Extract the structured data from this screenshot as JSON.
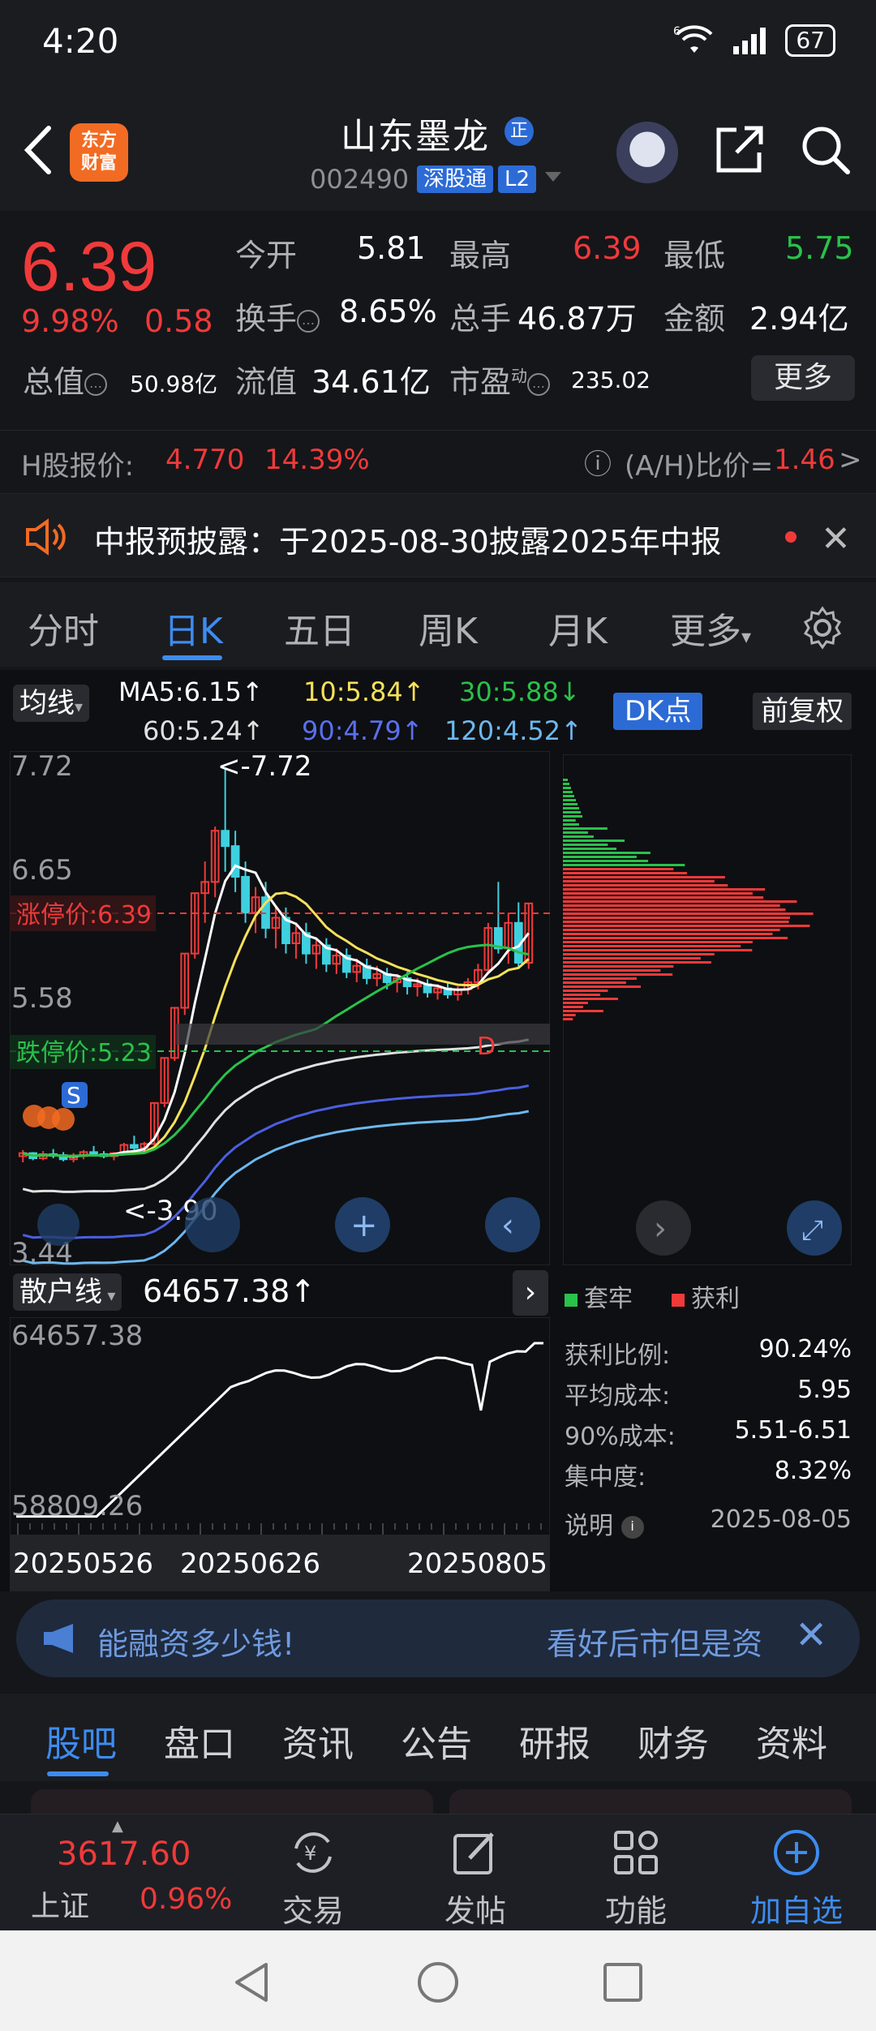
{
  "status": {
    "time": "4:20",
    "battery": "67",
    "wifi_label": "6"
  },
  "header": {
    "app_logo": "东方\n财富",
    "stock_name": "山东墨龙",
    "zheng_badge": "正",
    "stock_code": "002490",
    "sgt_badge": "深股通",
    "l2_badge": "L2"
  },
  "quote": {
    "price": "6.39",
    "pct": "9.98%",
    "chg": "0.58",
    "open_label": "今开",
    "open": "5.81",
    "high_label": "最高",
    "high": "6.39",
    "low_label": "最低",
    "low": "5.75",
    "turnover_label": "换手",
    "turnover": "8.65%",
    "volume_label": "总手",
    "volume": "46.87万",
    "amount_label": "金额",
    "amount": "2.94亿",
    "total_mv_label": "总值",
    "total_mv": "50.98亿",
    "float_mv_label": "流值",
    "float_mv": "34.61亿",
    "pe_label": "市盈",
    "pe_sup": "动",
    "pe": "235.02",
    "more_label": "更多",
    "h_label": "H股报价:",
    "h_price": "4.770",
    "h_premium": "14.39%",
    "ah_label": "(A/H)比价=",
    "ah_value": "1.46",
    "ah_arrow": ">"
  },
  "notice": {
    "text": "中报预披露：于2025-08-30披露2025年中报"
  },
  "ktabs": [
    "分时",
    "日K",
    "五日",
    "周K",
    "月K",
    "更多"
  ],
  "ktab_active": 1,
  "ma_row": {
    "selector": "均线",
    "ma5": "MA5:6.15↑",
    "ma10": "10:5.84↑",
    "ma30": "30:5.88↓",
    "ma60": "60:5.24↑",
    "ma90": "90:4.79↑",
    "ma120": "120:4.52↑",
    "dk": "DK点",
    "fuquan": "前复权"
  },
  "colors": {
    "ma5": "#ffffff",
    "ma10": "#f5e15a",
    "ma30": "#29c24a",
    "ma60": "#e0e0e0",
    "ma90": "#4a5fe0",
    "ma120": "#6cb8f0",
    "up": "#f03a3a",
    "down": "#3fd0e0"
  },
  "kline": {
    "y_labels": [
      "7.72",
      "6.65",
      "5.58",
      "3.44"
    ],
    "limit_up": "涨停价:6.39",
    "limit_down": "跌停价:5.23",
    "high_mark": "<-7.72",
    "low_mark": "<-3.90",
    "marker_d": "D",
    "marker_s": "S"
  },
  "chart_data": {
    "type": "candlestick",
    "title": "",
    "ylim": [
      3.44,
      7.72
    ],
    "x": [
      "20250526",
      "20250626",
      "20250805"
    ],
    "candles": [
      [
        3.92,
        3.98,
        3.86,
        3.95
      ],
      [
        3.95,
        3.96,
        3.88,
        3.9
      ],
      [
        3.9,
        3.97,
        3.88,
        3.94
      ],
      [
        3.94,
        3.99,
        3.9,
        3.93
      ],
      [
        3.93,
        3.96,
        3.87,
        3.89
      ],
      [
        3.89,
        3.95,
        3.86,
        3.92
      ],
      [
        3.92,
        3.98,
        3.89,
        3.96
      ],
      [
        3.96,
        4.02,
        3.92,
        3.94
      ],
      [
        3.94,
        3.97,
        3.9,
        3.92
      ],
      [
        3.92,
        3.96,
        3.88,
        3.95
      ],
      [
        3.95,
        4.05,
        3.93,
        4.03
      ],
      [
        4.03,
        4.12,
        3.98,
        4.0
      ],
      [
        4.0,
        4.06,
        3.95,
        4.04
      ],
      [
        4.04,
        4.44,
        4.02,
        4.44
      ],
      [
        4.44,
        4.88,
        4.4,
        4.88
      ],
      [
        4.88,
        5.37,
        4.85,
        5.37
      ],
      [
        5.37,
        5.9,
        5.3,
        5.9
      ],
      [
        5.9,
        6.49,
        5.85,
        6.49
      ],
      [
        6.49,
        6.8,
        6.2,
        6.6
      ],
      [
        6.6,
        7.14,
        6.45,
        7.1
      ],
      [
        7.1,
        7.72,
        6.7,
        6.95
      ],
      [
        6.95,
        7.1,
        6.5,
        6.65
      ],
      [
        6.65,
        6.8,
        6.2,
        6.3
      ],
      [
        6.3,
        6.55,
        6.1,
        6.45
      ],
      [
        6.45,
        6.6,
        6.05,
        6.15
      ],
      [
        6.15,
        6.35,
        5.95,
        6.25
      ],
      [
        6.25,
        6.35,
        5.9,
        6.0
      ],
      [
        6.0,
        6.2,
        5.85,
        6.1
      ],
      [
        6.1,
        6.2,
        5.8,
        5.9
      ],
      [
        5.9,
        6.05,
        5.75,
        5.98
      ],
      [
        5.98,
        6.05,
        5.72,
        5.8
      ],
      [
        5.8,
        5.95,
        5.7,
        5.88
      ],
      [
        5.88,
        5.95,
        5.66,
        5.72
      ],
      [
        5.72,
        5.85,
        5.62,
        5.78
      ],
      [
        5.78,
        5.85,
        5.6,
        5.66
      ],
      [
        5.66,
        5.78,
        5.58,
        5.7
      ],
      [
        5.7,
        5.76,
        5.55,
        5.62
      ],
      [
        5.62,
        5.7,
        5.52,
        5.66
      ],
      [
        5.66,
        5.72,
        5.5,
        5.58
      ],
      [
        5.58,
        5.66,
        5.48,
        5.6
      ],
      [
        5.6,
        5.65,
        5.47,
        5.52
      ],
      [
        5.52,
        5.6,
        5.45,
        5.56
      ],
      [
        5.56,
        5.62,
        5.46,
        5.5
      ],
      [
        5.5,
        5.58,
        5.44,
        5.55
      ],
      [
        5.55,
        5.66,
        5.5,
        5.62
      ],
      [
        5.62,
        5.8,
        5.55,
        5.74
      ],
      [
        5.74,
        6.2,
        5.7,
        6.15
      ],
      [
        6.15,
        6.6,
        5.9,
        5.95
      ],
      [
        5.95,
        6.3,
        5.8,
        6.2
      ],
      [
        6.2,
        6.4,
        5.75,
        5.81
      ],
      [
        5.81,
        6.39,
        5.75,
        6.39
      ]
    ]
  },
  "scatter": {
    "selector": "散户线",
    "value": "64657.38↑",
    "y_top": "64657.38",
    "y_bottom": "58809.26"
  },
  "dates": [
    "20250526",
    "20250626",
    "20250805"
  ],
  "distribution": {
    "legend_trap": "套牢",
    "legend_profit": "获利",
    "profit_ratio_label": "获利比例:",
    "profit_ratio": "90.24%",
    "avg_cost_label": "平均成本:",
    "avg_cost": "5.95",
    "cost90_label": "90%成本:",
    "cost90": "5.51-6.51",
    "concentration_label": "集中度:",
    "concentration": "8.32%",
    "explain_label": "说明",
    "date": "2025-08-05"
  },
  "promo": {
    "left": "能融资多少钱!",
    "right": "看好后市但是资"
  },
  "btabs": [
    "股吧",
    "盘口",
    "资讯",
    "公告",
    "研报",
    "财务",
    "资料"
  ],
  "footer": {
    "index_value": "3617.60",
    "index_name": "上证",
    "index_pct": "0.96%",
    "trade": "交易",
    "post": "发帖",
    "function": "功能",
    "add": "加自选"
  }
}
